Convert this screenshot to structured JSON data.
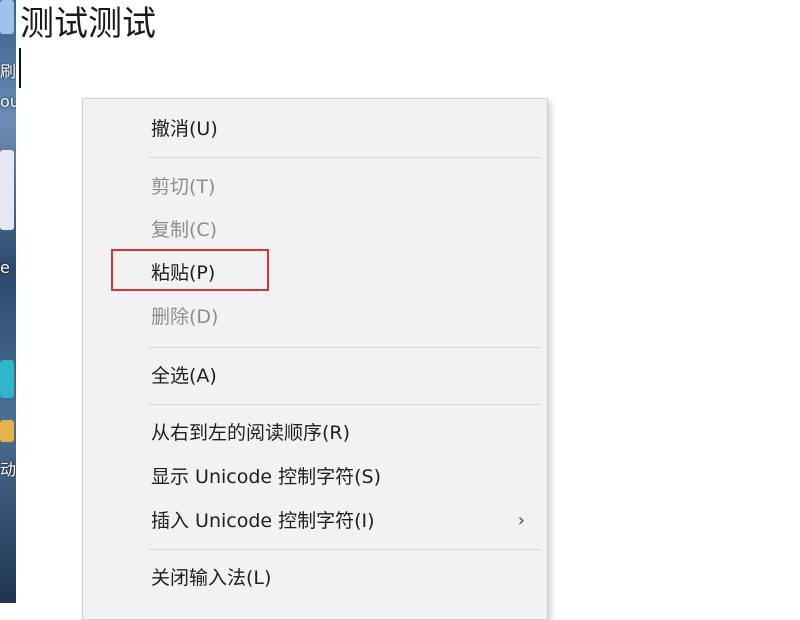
{
  "document": {
    "text": "测试测试"
  },
  "desktop": {
    "label_a": "刷",
    "label_b": "ou",
    "label_c": "e",
    "label_d": "动"
  },
  "context_menu": {
    "items": [
      {
        "label": "撤消(U)",
        "enabled": true
      },
      {
        "label": "剪切(T)",
        "enabled": false
      },
      {
        "label": "复制(C)",
        "enabled": false
      },
      {
        "label": "粘贴(P)",
        "enabled": true,
        "highlighted": true
      },
      {
        "label": "删除(D)",
        "enabled": false
      },
      {
        "label": "全选(A)",
        "enabled": true
      },
      {
        "label": "从右到左的阅读顺序(R)",
        "enabled": true
      },
      {
        "label": "显示 Unicode 控制字符(S)",
        "enabled": true
      },
      {
        "label": "插入 Unicode 控制字符(I)",
        "enabled": true,
        "submenu": true
      },
      {
        "label": "关闭输入法(L)",
        "enabled": true
      }
    ],
    "submenu_arrow": "›",
    "highlight_color": "#d9343b"
  }
}
